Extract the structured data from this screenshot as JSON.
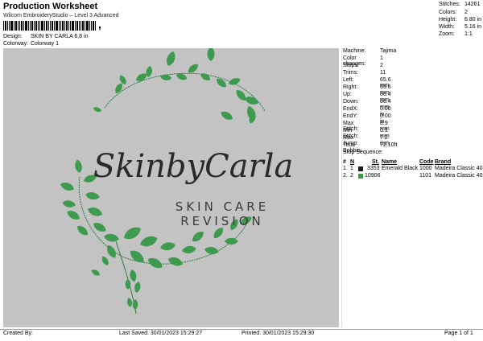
{
  "header": {
    "title": "Production Worksheet",
    "subtitle": "Wilcom EmbroideryStudio – Level 3 Advanced",
    "barcode_suffix": ","
  },
  "design_info": {
    "design_label": "Design:",
    "design_value": "SKIN BY CARLA 6,8 in",
    "colorway_label": "Colorway:",
    "colorway_value": "Colorway 1"
  },
  "summary": [
    {
      "label": "Stitches:",
      "value": "14261"
    },
    {
      "label": "Colors:",
      "value": "2"
    },
    {
      "label": "Height:",
      "value": "6.80 in"
    },
    {
      "label": "Width:",
      "value": "5.16 in"
    },
    {
      "label": "Zoom:",
      "value": "1:1"
    }
  ],
  "stats": [
    {
      "label": "Machine:",
      "value": "Tajima"
    },
    {
      "label": "Color changes:",
      "value": "1"
    },
    {
      "label": "Stops:",
      "value": "2"
    },
    {
      "label": "Trims:",
      "value": "11"
    },
    {
      "label": "Left:",
      "value": "65.6 mm"
    },
    {
      "label": "Right:",
      "value": "65.6 mm"
    },
    {
      "label": "Up:",
      "value": "86.4 mm"
    },
    {
      "label": "Down:",
      "value": "86.4 mm"
    },
    {
      "label": "EndX:",
      "value": "0.00 in"
    },
    {
      "label": "EndY:",
      "value": "0.00 in"
    },
    {
      "label": "Max Stitch:",
      "value": "8.9 mm"
    },
    {
      "label": "Min Stitch:",
      "value": "0.1 mm"
    },
    {
      "label": "Max Jump:",
      "value": "7.2 mm"
    },
    {
      "label": "Total Bobbin:",
      "value": "72.10ft"
    }
  ],
  "stop_sequence": {
    "title": "Stop Sequence:",
    "headers": [
      "#",
      "N",
      "St.",
      "Name",
      "Code",
      "Brand"
    ],
    "rows": [
      {
        "num": "1.",
        "n": "1",
        "color": "#1a1a1a",
        "st": "3353",
        "name": "Emerald Black",
        "code": "1000",
        "brand": "Madeira Classic 40"
      },
      {
        "num": "2.",
        "n": "2",
        "color": "#3a9a4a",
        "st": "10906",
        "name": "",
        "code": "1101",
        "brand": "Madeira Classic 40"
      }
    ]
  },
  "design_text": {
    "script": "SkinbyCarla",
    "line1": "SKIN CARE",
    "line2": "REVISION"
  },
  "colors": {
    "leaf": "#3e9a4e",
    "leaf_dark": "#2c7a3a",
    "text": "#2a2a2a",
    "canvas": "#c3c3c3"
  },
  "footer": {
    "created_by": "Created By:",
    "last_saved": "Last Saved: 30/01/2023 15:29:27",
    "printed": "Printed: 30/01/2023 15:29:30",
    "page": "Page 1 of 1"
  }
}
